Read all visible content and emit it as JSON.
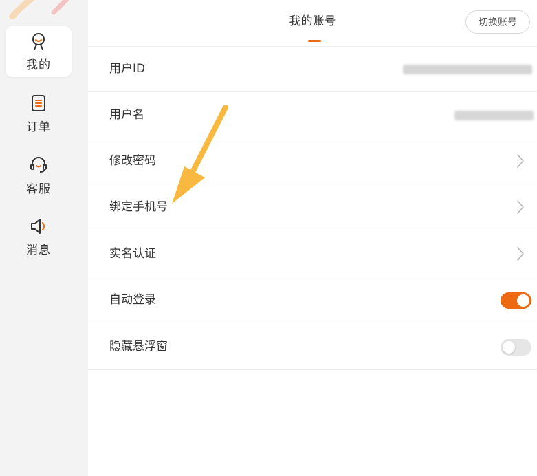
{
  "colors": {
    "accent": "#ee6a12",
    "sidebar_bg": "#f3f3f3",
    "annotation_arrow": "#f9b940"
  },
  "sidebar": {
    "items": [
      {
        "label": "我的",
        "icon": "user-icon",
        "active": true
      },
      {
        "label": "订单",
        "icon": "document-icon",
        "active": false
      },
      {
        "label": "客服",
        "icon": "headset-icon",
        "active": false
      },
      {
        "label": "消息",
        "icon": "speaker-icon",
        "active": false
      }
    ]
  },
  "header": {
    "title": "我的账号",
    "switch_account_label": "切换账号"
  },
  "rows": {
    "user_id": {
      "label": "用户ID"
    },
    "username": {
      "label": "用户名"
    },
    "change_password": {
      "label": "修改密码"
    },
    "bind_phone": {
      "label": "绑定手机号"
    },
    "real_name_auth": {
      "label": "实名认证"
    },
    "auto_login": {
      "label": "自动登录",
      "enabled": true
    },
    "hide_float_window": {
      "label": "隐藏悬浮窗",
      "enabled": false
    }
  }
}
